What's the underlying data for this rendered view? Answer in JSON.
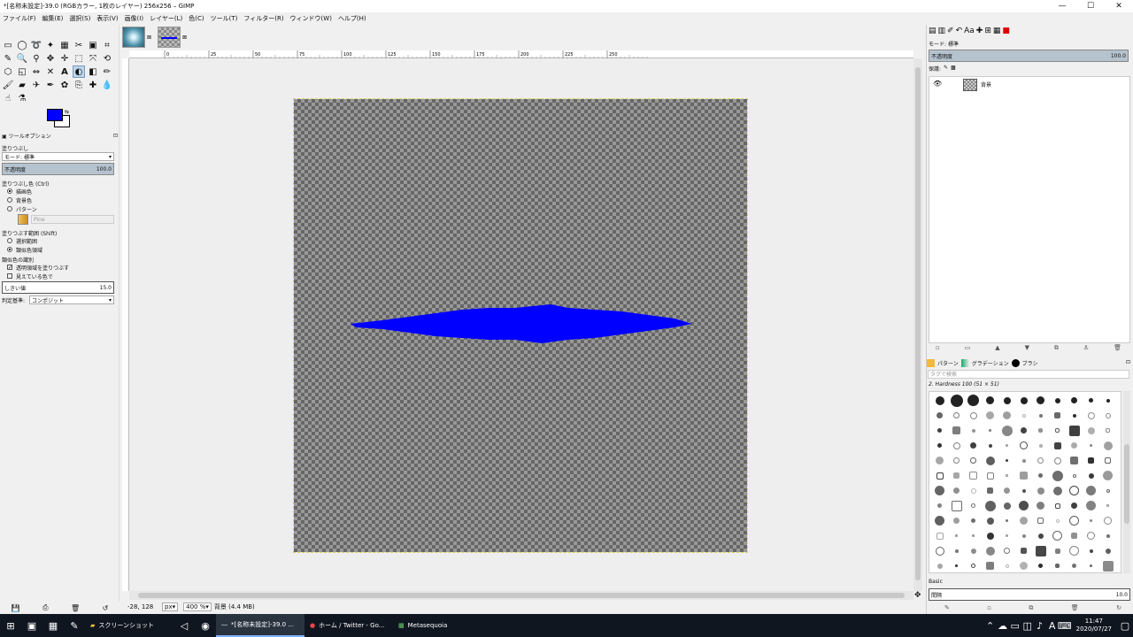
{
  "window": {
    "title": "*[名称未設定]-39.0 (RGBカラー, 1枚のレイヤー) 256x256 – GIMP",
    "minimize": "—",
    "maximize": "☐",
    "close": "✕"
  },
  "menu": [
    "ファイル(F)",
    "編集(E)",
    "選択(S)",
    "表示(V)",
    "画像(I)",
    "レイヤー(L)",
    "色(C)",
    "ツール(T)",
    "フィルター(R)",
    "ウィンドウ(W)",
    "ヘルプ(H)"
  ],
  "colors": {
    "foreground": "#0000ff",
    "background": "#ffffff",
    "shape": "#0000ff"
  },
  "tool_options": {
    "tab_label": "ツールオプション",
    "tool_name": "塗りつぶし",
    "mode_label": "モード:",
    "mode_value": "標準",
    "opacity_label": "不透明度",
    "opacity_value": "100.0",
    "fill_type_label": "塗りつぶし色 (Ctrl)",
    "fill_fg": "描画色",
    "fill_bg": "背景色",
    "fill_pattern": "パターン",
    "pattern_name": "Pine",
    "area_label": "塗りつぶす範囲 (Shift)",
    "area_selection": "選択範囲",
    "area_similar": "類似色領域",
    "similar_label": "類似色の識別",
    "fill_transparent": "透明領域を塗りつぶす",
    "sample_merged": "見えている色で",
    "threshold_label": "しきい値",
    "threshold_value": "15.0",
    "criterion_label": "判定基準:",
    "criterion_value": "コンポジット"
  },
  "status": {
    "coords": "-28, 128",
    "unit": "px",
    "zoom": "400 %",
    "info": "背景 (4.4 MB)"
  },
  "ruler": {
    "h_ticks": [
      "0",
      "25",
      "50",
      "75",
      "100",
      "125",
      "150",
      "175",
      "200",
      "225",
      "250"
    ]
  },
  "layers": {
    "mode_label": "モード:",
    "mode_value": "標準",
    "opacity_label": "不透明度",
    "opacity_value": "100.0",
    "lock_label": "保護:",
    "layer_name": "背景"
  },
  "brushes": {
    "tabs": [
      "パターン",
      "グラデーション",
      "ブラシ"
    ],
    "filter_placeholder": "タグで検索",
    "current": "2. Hardness 100 (51 × 51)",
    "preset": "Basic",
    "spacing_label": "間隔",
    "spacing_value": "10.0"
  },
  "taskbar": {
    "apps": [
      "スクリーンショット",
      "*[名称未設定]-39.0 ...",
      "ホーム / Twitter - Go...",
      "Metasequoia"
    ],
    "time": "11:47",
    "date": "2020/07/27",
    "ime": "A"
  }
}
